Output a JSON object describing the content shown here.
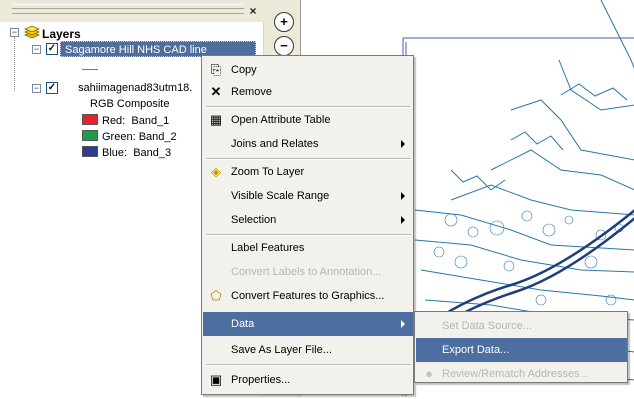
{
  "toc": {
    "root_label": "Layers",
    "layer1": "Sagamore Hill NHS CAD line",
    "layer2": "sahiimagenad83utm18.",
    "composite": "RGB Composite",
    "bands": [
      {
        "channel": "Red:",
        "band": "Band_1",
        "color": "#e8202a"
      },
      {
        "channel": "Green:",
        "band": "Band_2",
        "color": "#1c9a4e"
      },
      {
        "channel": "Blue:",
        "band": "Band_3",
        "color": "#2b3d93"
      }
    ],
    "close_glyph": "×"
  },
  "tools": {
    "zoom_in": "+",
    "zoom_out": "−"
  },
  "context_menu": {
    "items": [
      {
        "label": "Copy",
        "icon": "copy-icon",
        "glyph": "⎘"
      },
      {
        "label": "Remove",
        "icon": "remove-icon",
        "glyph": "✕"
      },
      {
        "label": "Open Attribute Table",
        "icon": "table-icon",
        "glyph": "▦"
      },
      {
        "label": "Joins and Relates",
        "submenu": true
      },
      {
        "label": "Zoom To Layer",
        "icon": "zoom-to-layer-icon",
        "glyph": "◈"
      },
      {
        "label": "Visible Scale Range",
        "submenu": true
      },
      {
        "label": "Selection",
        "submenu": true
      },
      {
        "label": "Label Features"
      },
      {
        "label": "Convert Labels to Annotation...",
        "disabled": true
      },
      {
        "label": "Convert Features to Graphics...",
        "icon": "convert-graphics-icon",
        "glyph": "⬠"
      },
      {
        "label": "Data",
        "submenu": true,
        "highlighted": true
      },
      {
        "label": "Save As Layer File..."
      },
      {
        "label": "Properties...",
        "icon": "properties-icon",
        "glyph": "▣"
      }
    ]
  },
  "data_submenu": {
    "items": [
      {
        "label": "Set Data Source...",
        "disabled": true
      },
      {
        "label": "Export Data...",
        "highlighted": true
      },
      {
        "label": "Review/Rematch Addresses...",
        "disabled": true,
        "icon": "geocode-icon",
        "glyph": "●"
      }
    ]
  },
  "colors": {
    "highlight": "#4d6ea0",
    "map_line": "#2a78a8",
    "map_boundary": "#4a5fa8"
  }
}
